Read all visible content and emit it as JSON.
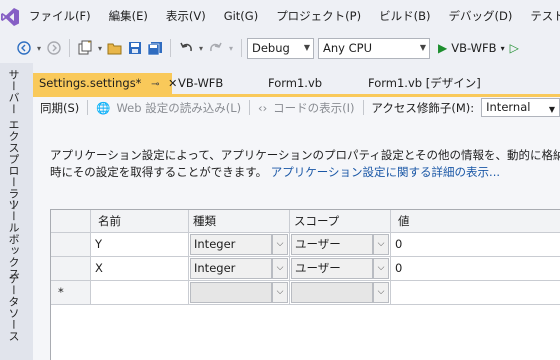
{
  "menu": {
    "items": [
      {
        "label": "ファイル(F)"
      },
      {
        "label": "編集(E)"
      },
      {
        "label": "表示(V)"
      },
      {
        "label": "Git(G)"
      },
      {
        "label": "プロジェクト(P)"
      },
      {
        "label": "ビルド(B)"
      },
      {
        "label": "デバッグ(D)"
      },
      {
        "label": "テスト(S)"
      }
    ]
  },
  "toolbar": {
    "configuration": "Debug",
    "platform": "Any CPU",
    "run_label": "VB-WFB"
  },
  "sidebar": {
    "tabs": [
      {
        "label": "サーバー エクスプローラー"
      },
      {
        "label": "ツールボックス"
      },
      {
        "label": "データソース"
      }
    ]
  },
  "doc_tabs": [
    {
      "label": "Settings.settings*",
      "active": true
    },
    {
      "label": "VB-WFB"
    },
    {
      "label": "Form1.vb"
    },
    {
      "label": "Form1.vb [デザイン]"
    }
  ],
  "editor_toolbar": {
    "sync": "同期(S)",
    "load_web": "Web 設定の読み込み(L)",
    "view_code": "コードの表示(I)",
    "access_label": "アクセス修飾子(M):",
    "access_value": "Internal"
  },
  "description": {
    "line1": "アプリケーション設定によって、アプリケーションのプロパティ設定とその他の情報を、動的に格納、取得するこ",
    "line2": "時にその設定を取得することができます。",
    "link": "アプリケーション設定に関する詳細の表示..."
  },
  "grid": {
    "headers": {
      "name": "名前",
      "type": "種類",
      "scope": "スコープ",
      "value": "値"
    },
    "rows": [
      {
        "name": "Y",
        "type": "Integer",
        "scope": "ユーザー",
        "value": "0"
      },
      {
        "name": "X",
        "type": "Integer",
        "scope": "ユーザー",
        "value": "0"
      }
    ],
    "new_row_marker": "*"
  },
  "colors": {
    "active_tab": "#f9c95a",
    "link": "#1a57a6",
    "run_green": "#1d8e2e",
    "logo_purple": "#865fc5"
  }
}
